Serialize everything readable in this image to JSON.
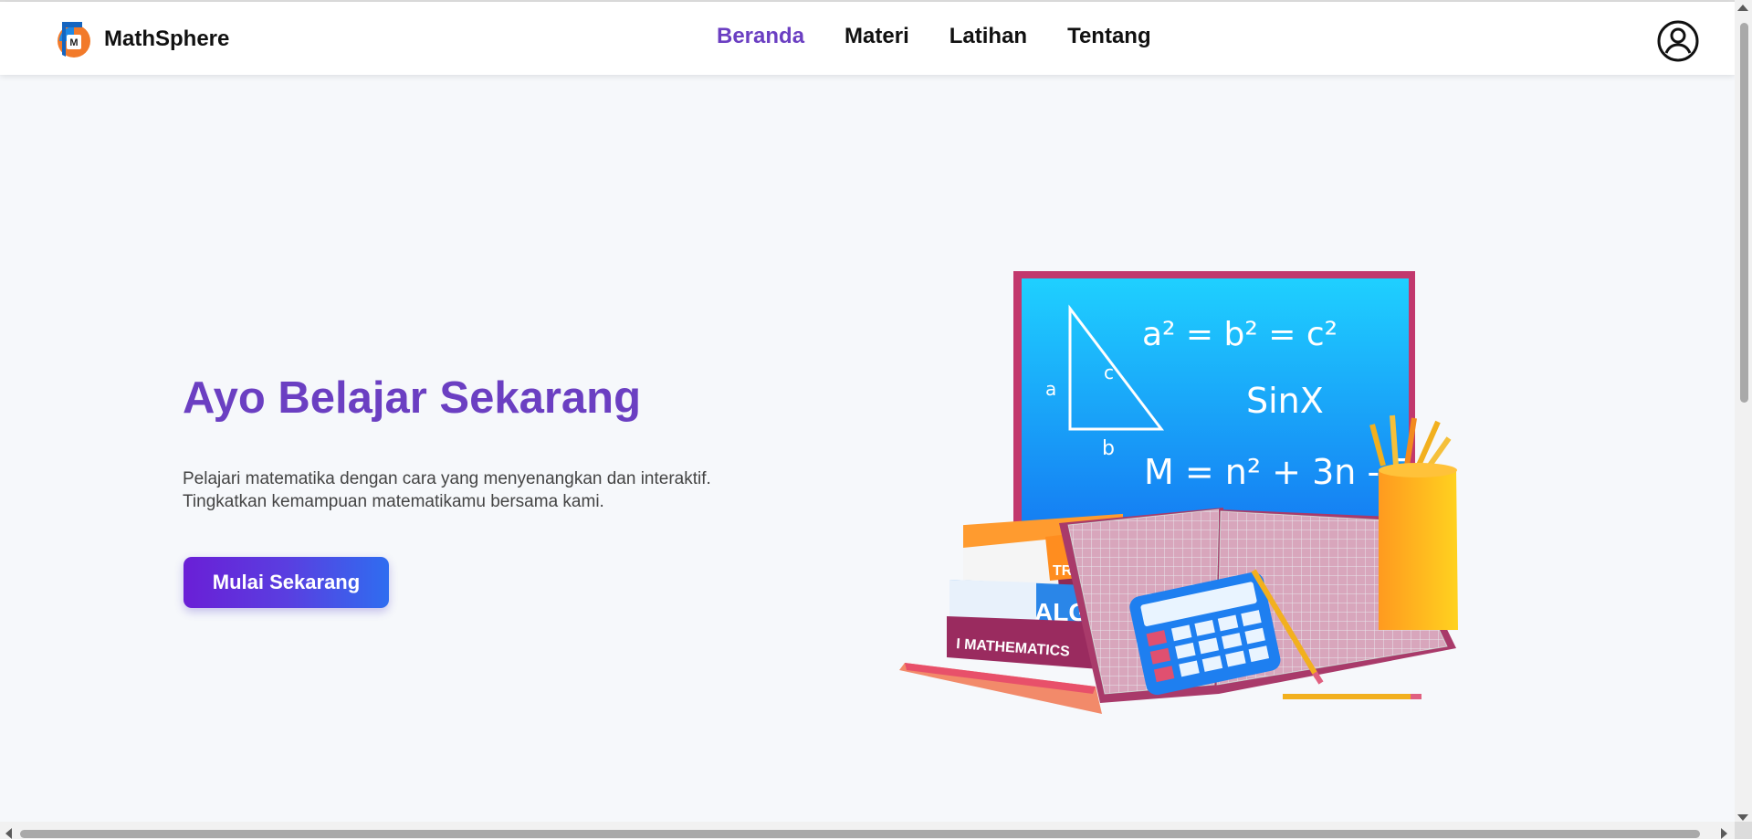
{
  "header": {
    "brand_name": "MathSphere",
    "logo_letter": "M",
    "nav": [
      {
        "label": "Beranda",
        "active": true
      },
      {
        "label": "Materi",
        "active": false
      },
      {
        "label": "Latihan",
        "active": false
      },
      {
        "label": "Tentang",
        "active": false
      }
    ],
    "profile_icon": "user-circle-icon"
  },
  "hero": {
    "title": "Ayo Belajar Sekarang",
    "description_line1": "Pelajari matematika dengan cara yang menyenangkan dan interaktif.",
    "description_line2": "Tingkatkan kemampuan matematikamu bersama kami.",
    "cta_label": "Mulai Sekarang"
  },
  "illustration": {
    "board_formula_1": "a² = b² = c²",
    "board_formula_2": "SinX",
    "board_formula_3": "M = n² + 3n - 5",
    "triangle_side_a": "a",
    "triangle_side_b": "b",
    "triangle_side_c": "c",
    "book_1": "TRIG",
    "book_2": "ALGE",
    "book_3": "I MATHEMATICS"
  },
  "colors": {
    "accent": "#6b3fc2",
    "cta_start": "#6a1fd6",
    "cta_end": "#2f6df0",
    "board": "#17a8f5",
    "background": "#f6f8fb"
  }
}
